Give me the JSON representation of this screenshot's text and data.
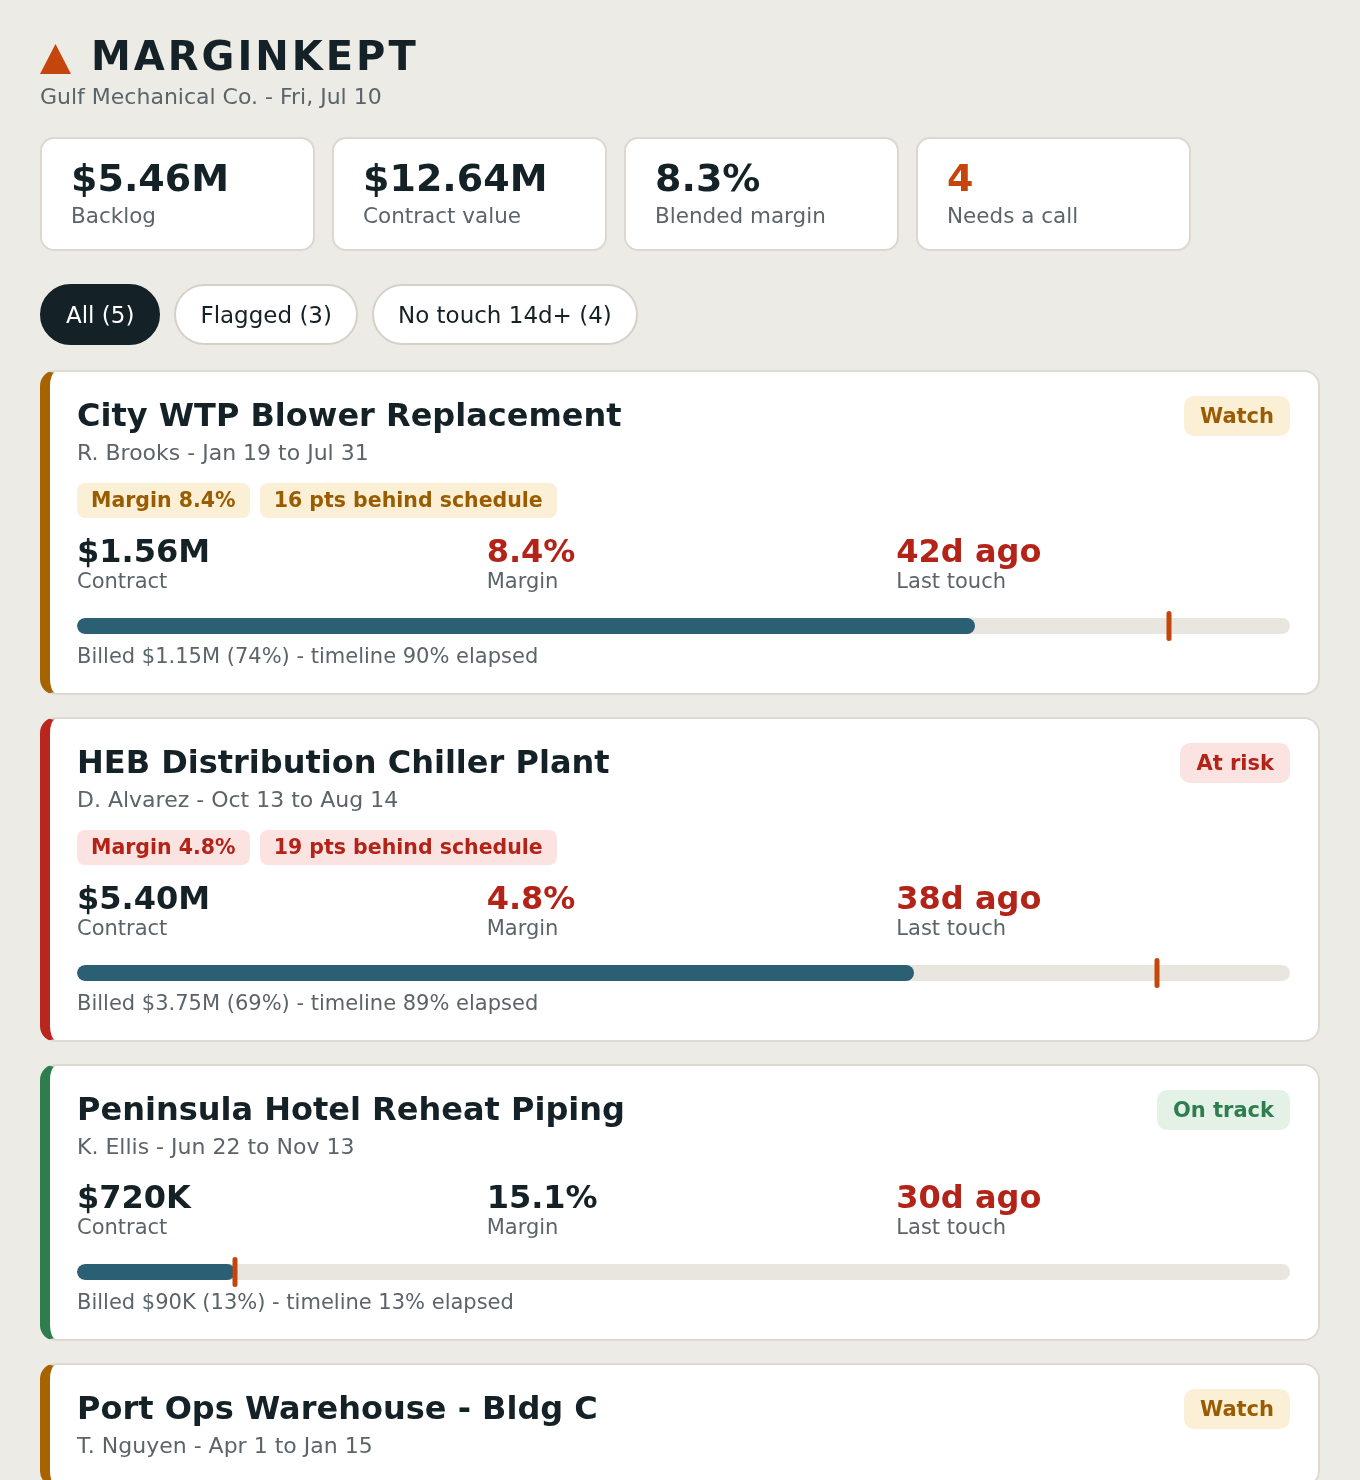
{
  "app": {
    "name": "MARGINKEPT",
    "subtitle": "Gulf Mechanical Co. - Fri, Jul 10"
  },
  "kpis": [
    {
      "value": "$5.46M",
      "label": "Backlog",
      "alert": false
    },
    {
      "value": "$12.64M",
      "label": "Contract value",
      "alert": false
    },
    {
      "value": "8.3%",
      "label": "Blended margin",
      "alert": false
    },
    {
      "value": "4",
      "label": "Needs a call",
      "alert": true
    }
  ],
  "filters": [
    {
      "label": "All (5)",
      "selected": true
    },
    {
      "label": "Flagged (3)",
      "selected": false
    },
    {
      "label": "No touch 14d+ (4)",
      "selected": false
    }
  ],
  "projects": [
    {
      "title": "City WTP Blower Replacement",
      "subtitle": "R. Brooks - Jan 19 to Jul 31",
      "status": {
        "label": "Watch",
        "kind": "watch"
      },
      "tags": [
        {
          "label": "Margin 8.4%",
          "kind": "watch"
        },
        {
          "label": "16 pts behind schedule",
          "kind": "watch"
        }
      ],
      "metrics": [
        {
          "value": "$1.56M",
          "label": "Contract",
          "alert": false
        },
        {
          "value": "8.4%",
          "label": "Margin",
          "alert": true
        },
        {
          "value": "42d ago",
          "label": "Last touch",
          "alert": true
        }
      ],
      "billing": {
        "level": 0.74
      },
      "timeline": {
        "level": 0.9
      },
      "caption": "Billed $1.15M (74%) - timeline 90% elapsed"
    },
    {
      "title": "HEB Distribution Chiller Plant",
      "subtitle": "D. Alvarez - Oct 13 to Aug 14",
      "status": {
        "label": "At risk",
        "kind": "risk"
      },
      "tags": [
        {
          "label": "Margin 4.8%",
          "kind": "risk"
        },
        {
          "label": "19 pts behind schedule",
          "kind": "risk"
        }
      ],
      "metrics": [
        {
          "value": "$5.40M",
          "label": "Contract",
          "alert": false
        },
        {
          "value": "4.8%",
          "label": "Margin",
          "alert": true
        },
        {
          "value": "38d ago",
          "label": "Last touch",
          "alert": true
        }
      ],
      "billing": {
        "level": 0.69
      },
      "timeline": {
        "level": 0.89
      },
      "caption": "Billed $3.75M (69%) - timeline 89% elapsed"
    },
    {
      "title": "Peninsula Hotel Reheat Piping",
      "subtitle": "K. Ellis - Jun 22 to Nov 13",
      "status": {
        "label": "On track",
        "kind": "ontrack"
      },
      "metrics": [
        {
          "value": "$720K",
          "label": "Contract",
          "alert": false
        },
        {
          "value": "15.1%",
          "label": "Margin",
          "alert": false
        },
        {
          "value": "30d ago",
          "label": "Last touch",
          "alert": true
        }
      ],
      "billing": {
        "level": 0.13
      },
      "timeline": {
        "level": 0.13
      },
      "caption": "Billed $90K (13%) - timeline 13% elapsed"
    },
    {
      "title": "Port Ops Warehouse - Bldg C",
      "subtitle": "T. Nguyen - Apr 1 to Jan 15",
      "status": {
        "label": "Watch",
        "kind": "watch"
      }
    }
  ]
}
